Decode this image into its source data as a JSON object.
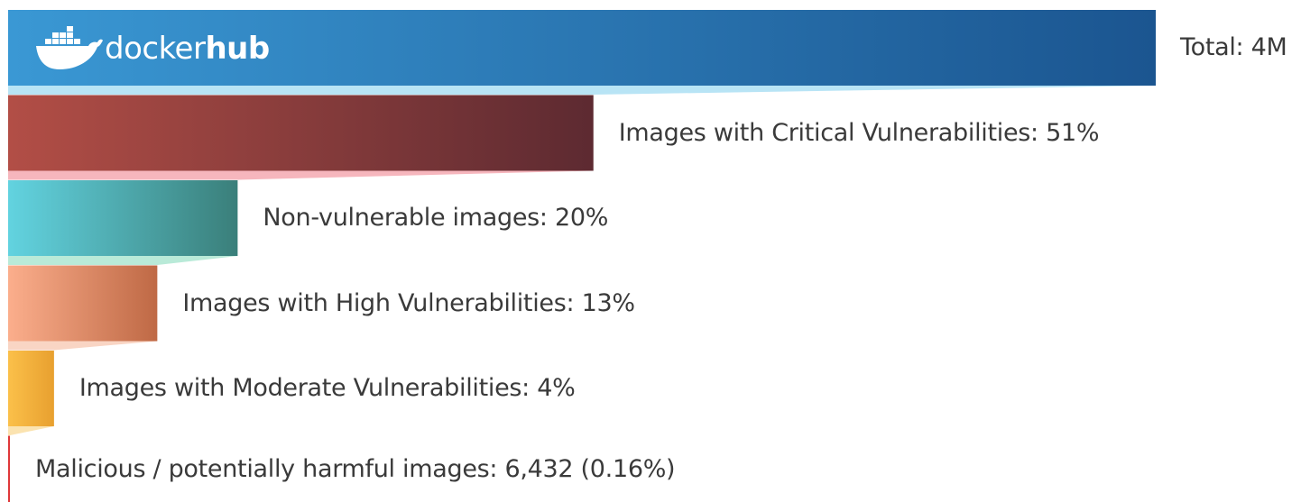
{
  "brand": {
    "word1": "docker",
    "word2": "hub",
    "icon": "docker-whale-icon"
  },
  "chart_data": {
    "type": "bar",
    "orientation": "horizontal-funnel",
    "categories": [
      "Total",
      "Images with Critical Vulnerabilities",
      "Non-vulnerable images",
      "Images with High Vulnerabilities",
      "Images with Moderate Vulnerabilities",
      "Malicious / potentially harmful images"
    ],
    "labels": [
      "Total: 4M",
      "Images with Critical Vulnerabilities: 51%",
      "Non-vulnerable images: 20%",
      "Images with High Vulnerabilities: 13%",
      "Images with Moderate Vulnerabilities: 4%",
      "Malicious / potentially harmful images: 6,432 (0.16%)"
    ],
    "values": [
      4000000,
      2040000,
      800000,
      520000,
      160000,
      6432
    ],
    "percent_of_total": [
      100,
      51,
      20,
      13,
      4,
      0.16
    ],
    "colors": [
      {
        "start": "#3a98d4",
        "end": "#1b5590",
        "connector": "#b8e4f5"
      },
      {
        "start": "#b24e46",
        "end": "#5d2a31",
        "connector": "#f6b6bd"
      },
      {
        "start": "#62d3e0",
        "end": "#3a7f7a",
        "connector": "#b9ead8"
      },
      {
        "start": "#fbae8c",
        "end": "#bf6945",
        "connector": "#f9d5c4"
      },
      {
        "start": "#fbc04a",
        "end": "#e8a02f",
        "connector": "#fbe3b0"
      },
      {
        "start": "#e0383a",
        "end": "#e0383a",
        "connector": "#e0383a"
      }
    ]
  }
}
